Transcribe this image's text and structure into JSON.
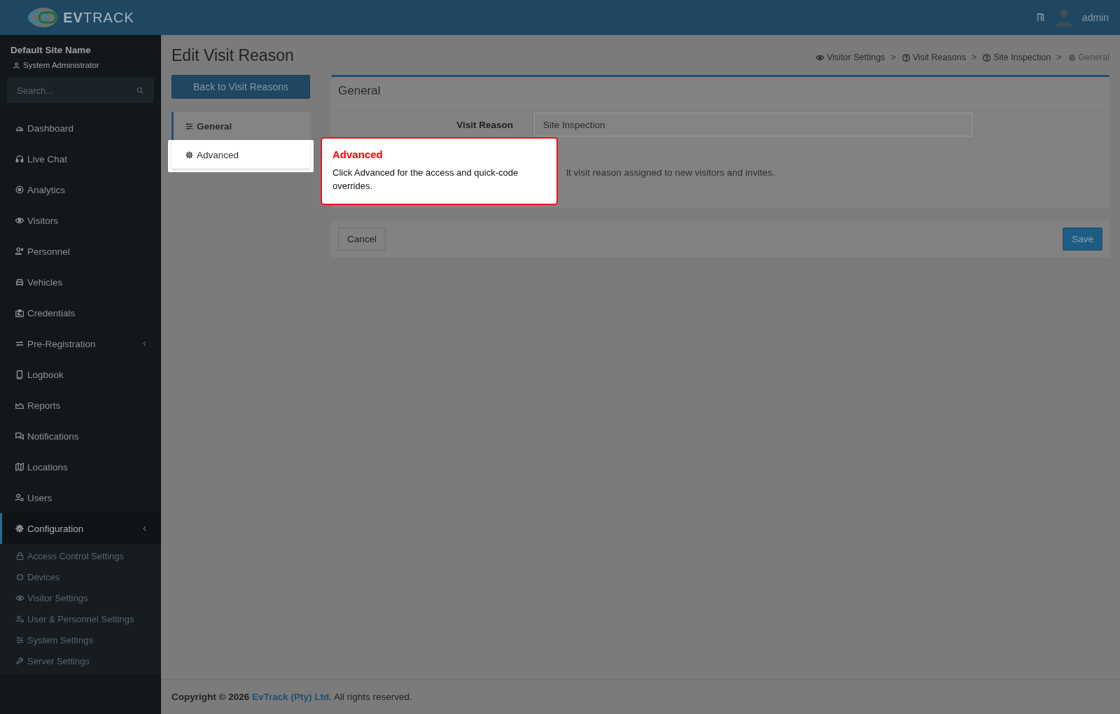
{
  "header": {
    "logo": "**EV**TRACK",
    "user": "admin"
  },
  "sidebar": {
    "site_name": "Default Site Name",
    "role": "System Administrator",
    "search": {
      "placeholder": "Search..."
    },
    "items": [
      {
        "label": "Dashboard",
        "selected": false,
        "submenu": false
      },
      {
        "label": "Live Chat",
        "selected": false,
        "submenu": false
      },
      {
        "label": "Analytics",
        "selected": false,
        "submenu": false
      },
      {
        "label": "Visitors",
        "selected": false,
        "submenu": false
      },
      {
        "label": "Personnel",
        "selected": false,
        "submenu": false
      },
      {
        "label": "Vehicles",
        "selected": false,
        "submenu": false
      },
      {
        "label": "Credentials",
        "selected": false,
        "submenu": false
      },
      {
        "label": "Pre-Registration",
        "selected": false,
        "submenu": true
      },
      {
        "label": "Logbook",
        "selected": false,
        "submenu": false
      },
      {
        "label": "Reports",
        "selected": false,
        "submenu": false
      },
      {
        "label": "Notifications",
        "selected": false,
        "submenu": false
      },
      {
        "label": "Locations",
        "selected": false,
        "submenu": false
      },
      {
        "label": "Users",
        "selected": false,
        "submenu": false
      },
      {
        "label": "Configuration",
        "selected": true,
        "submenu": true,
        "children": [
          {
            "label": "Access Control Settings"
          },
          {
            "label": "Devices"
          },
          {
            "label": "Visitor Settings"
          },
          {
            "label": "User & Personnel Settings"
          },
          {
            "label": "System Settings"
          },
          {
            "label": "Server Settings"
          }
        ]
      }
    ]
  },
  "page": {
    "title": "Edit Visit Reason",
    "breadcrumbs": [
      {
        "label": "Visitor Settings",
        "current": false
      },
      {
        "separator": ">",
        "label": "Visit Reasons",
        "current": false
      },
      {
        "separator": ">",
        "label": "Site Inspection",
        "current": false
      },
      {
        "separator": ">",
        "label": "General",
        "current": true
      }
    ],
    "back_button": "Back to Visit Reasons",
    "tabs": [
      {
        "label": "General",
        "selected": true,
        "highlighted": false
      },
      {
        "label": "Advanced",
        "selected": false,
        "highlighted": true
      }
    ],
    "card_title": "General",
    "fields": [
      {
        "label": "Visit Reason",
        "value": "Site Inspection"
      }
    ],
    "help_text": "lt visit reason assigned to new visitors and invites.",
    "cancel_button": "Cancel",
    "save_button": "Save"
  },
  "tooltip": {
    "title": "Advanced",
    "text": "Click Advanced for the access and quick-code overrides."
  },
  "footer": {
    "copyright": "Copyright © 2026",
    "company_link": "EvTrack (Pty) Ltd.",
    "rights": "All rights reserved."
  }
}
